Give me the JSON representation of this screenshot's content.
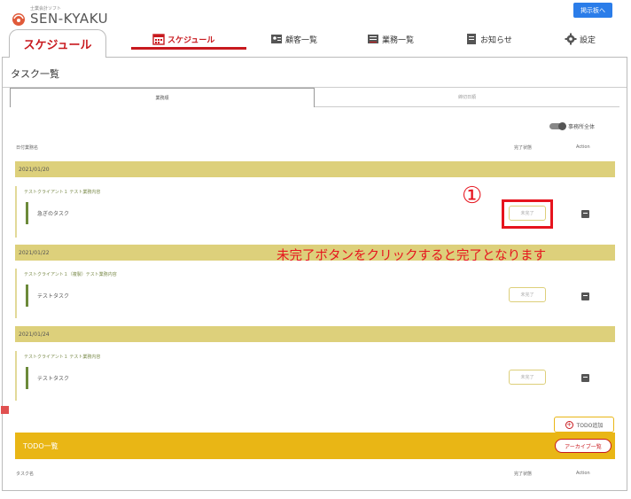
{
  "header": {
    "logo_sub": "士業会計ソフト",
    "logo_text": "SEN-KYAKU",
    "board_button": "掲示板へ"
  },
  "nav": {
    "page_tab": "スケジュール",
    "tabs": [
      {
        "label": "スケジュール",
        "icon": "calendar-icon",
        "active": true
      },
      {
        "label": "顧客一覧",
        "icon": "contacts-icon",
        "active": false
      },
      {
        "label": "業務一覧",
        "icon": "list-icon",
        "active": false
      },
      {
        "label": "お知らせ",
        "icon": "notice-icon",
        "active": false
      },
      {
        "label": "設定",
        "icon": "gear-icon",
        "active": false
      }
    ]
  },
  "main": {
    "title": "タスク一覧",
    "sort_tabs": [
      "業務順",
      "締切日順"
    ],
    "toggle_label": "事務所全体",
    "columns": {
      "date_name": "日付業務名",
      "status": "完了状態",
      "action": "Action"
    },
    "groups": [
      {
        "date": "2021/01/20",
        "client": "テストクライアント１ テスト業務内容",
        "task": "急ぎのタスク",
        "status": "未完了"
      },
      {
        "date": "2021/01/22",
        "client": "テストクライアント１（複製）テスト業務内容",
        "task": "テストタスク",
        "status": "未完了"
      },
      {
        "date": "2021/01/24",
        "client": "テストクライアント１ テスト業務内容",
        "task": "テストタスク",
        "status": "未完了"
      }
    ],
    "annotation_number": "①",
    "annotation_text": "未完了ボタンをクリックすると完了となります",
    "todo": {
      "add_label": "TODO追加",
      "title": "TODO一覧",
      "archive_label": "アーカイブ一覧",
      "columns": {
        "task_name": "タスク名",
        "status": "完了状態",
        "action": "Action"
      }
    }
  },
  "colors": {
    "accent": "#c8191e",
    "date_bar": "#ddd07b",
    "todo_bar": "#e9b615",
    "blue": "#2b7de9",
    "annotation": "#e6141e"
  }
}
